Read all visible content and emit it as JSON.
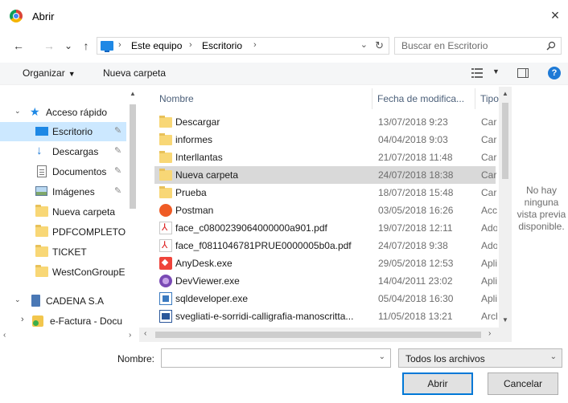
{
  "window": {
    "title": "Abrir",
    "close_glyph": "×"
  },
  "nav": {
    "back": "←",
    "forward": "→",
    "recent": "⌄",
    "up": "↑",
    "address_segments": [
      "Este equipo",
      "Escritorio"
    ],
    "address_sep": "›",
    "search_placeholder": "Buscar en Escritorio"
  },
  "toolbar": {
    "organize_label": "Organizar",
    "new_folder_label": "Nueva carpeta",
    "help_label": "?"
  },
  "sidebar": {
    "items": [
      {
        "label": "Acceso rápido",
        "icon": "star-icon",
        "expanded": true
      },
      {
        "label": "Escritorio",
        "icon": "desktop-icon",
        "pinned": true,
        "selected": true
      },
      {
        "label": "Descargas",
        "icon": "download-icon",
        "pinned": true
      },
      {
        "label": "Documentos",
        "icon": "document-icon",
        "pinned": true
      },
      {
        "label": "Imágenes",
        "icon": "pictures-icon",
        "pinned": true
      },
      {
        "label": "Nueva carpeta",
        "icon": "folder-icon"
      },
      {
        "label": "PDFCOMPLETO",
        "icon": "folder-icon"
      },
      {
        "label": "TICKET",
        "icon": "folder-icon"
      },
      {
        "label": "WestConGroupE",
        "icon": "folder-icon"
      },
      {
        "label": "CADENA S.A",
        "icon": "server-icon",
        "expanded": true
      },
      {
        "label": "e-Factura - Docu",
        "icon": "efactura-icon",
        "expanded": false
      }
    ]
  },
  "file_list": {
    "columns": [
      "Nombre",
      "Fecha de modifica...",
      "Tipo"
    ],
    "rows": [
      {
        "name": "Descargar",
        "date": "13/07/2018 9:23",
        "type": "Carpeta",
        "icon": "folder-icon"
      },
      {
        "name": "informes",
        "date": "04/04/2018 9:03",
        "type": "Carpeta",
        "icon": "folder-icon"
      },
      {
        "name": "Interllantas",
        "date": "21/07/2018 11:48",
        "type": "Carpeta",
        "icon": "folder-icon"
      },
      {
        "name": "Nueva carpeta",
        "date": "24/07/2018 18:38",
        "type": "Carpeta",
        "icon": "folder-icon",
        "selected": true
      },
      {
        "name": "Prueba",
        "date": "18/07/2018 15:48",
        "type": "Carpeta",
        "icon": "folder-icon"
      },
      {
        "name": "Postman",
        "date": "03/05/2018 16:26",
        "type": "Acceso",
        "icon": "postman-icon"
      },
      {
        "name": "face_c0800239064000000a901.pdf",
        "date": "19/07/2018 12:11",
        "type": "Adobe",
        "icon": "pdf-icon"
      },
      {
        "name": "face_f0811046781PRUE0000005b0a.pdf",
        "date": "24/07/2018 9:38",
        "type": "Adobe",
        "icon": "pdf-icon"
      },
      {
        "name": "AnyDesk.exe",
        "date": "29/05/2018 12:53",
        "type": "Aplicación",
        "icon": "anydesk-icon"
      },
      {
        "name": "DevViewer.exe",
        "date": "14/04/2011 23:02",
        "type": "Aplicación",
        "icon": "devviewer-icon"
      },
      {
        "name": "sqldeveloper.exe",
        "date": "05/04/2018 16:30",
        "type": "Aplicación",
        "icon": "sqldeveloper-icon"
      },
      {
        "name": "svegliati-e-sorridi-calligrafia-manoscritta...",
        "date": "11/05/2018 13:21",
        "type": "Archivo",
        "icon": "word-icon"
      }
    ]
  },
  "preview": {
    "text_lines": [
      "No hay",
      "ninguna",
      "vista previa",
      "disponible."
    ]
  },
  "footer": {
    "name_label": "Nombre:",
    "name_value": "",
    "filter_value": "Todos los archivos",
    "open_label": "Abrir",
    "cancel_label": "Cancelar"
  },
  "colors": {
    "accent": "#0078d7",
    "selection_nav": "#cce8ff",
    "selection_row": "#d9d9d9",
    "folder": "#f8d776"
  }
}
